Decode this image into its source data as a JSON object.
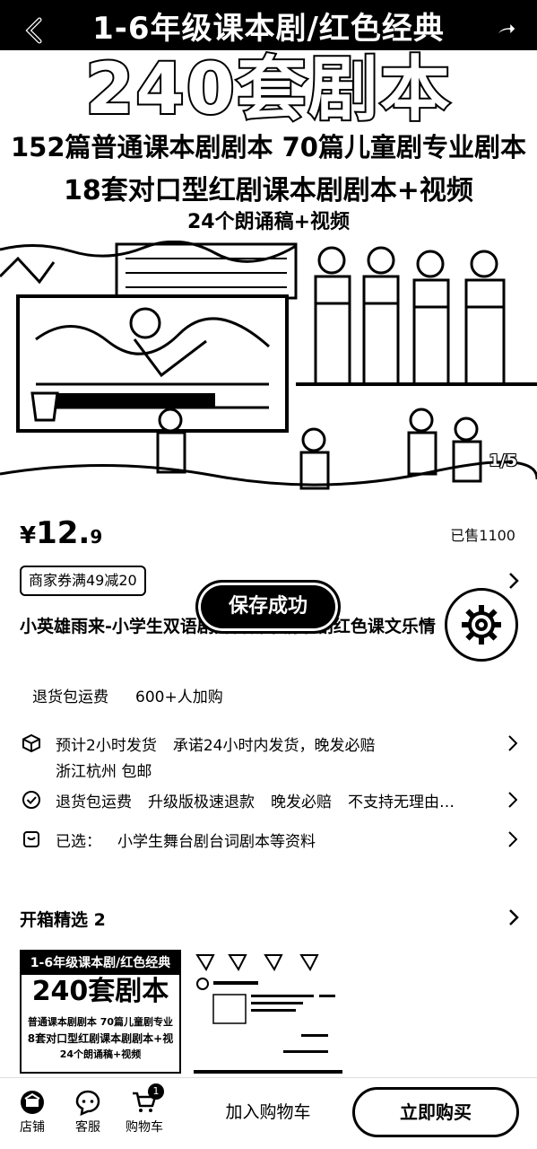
{
  "banner": {
    "header": "1-6年级课本剧/红色经典",
    "big_title": "240套剧本",
    "line1": "152篇普通课本剧剧本 70篇儿童剧专业剧本",
    "line2": "18套对口型红剧课本剧剧本+视频",
    "line3": "24个朗诵稿+视频"
  },
  "image_counter": "1/5",
  "price": {
    "currency": "¥",
    "integer": "12.",
    "decimal": "9"
  },
  "sold": "已售1100",
  "coupon": "商家券满49减20",
  "toast": "保存成功",
  "title": "小英雄雨来-小学生双语剧舞台剧本情景剧红色课文乐情",
  "tags": [
    "退货包运费",
    "600+人加购"
  ],
  "shipping": {
    "eta": "预计2小时发货",
    "promise": "承诺24小时内发货，晚发必赔",
    "origin": "浙江杭州 包邮"
  },
  "service": [
    "退货包运费",
    "升级版极速退款",
    "晚发必赔",
    "不支持无理由…"
  ],
  "selected": {
    "label": "已选：",
    "value": "小学生舞台剧台词剧本等资料"
  },
  "unboxing": {
    "title": "开箱精选 2",
    "thumb1": {
      "header": "1-6年级课本剧/红色经典",
      "big": "240套剧本",
      "l1": "普通课本剧剧本 70篇儿童剧专业",
      "l2": "8套对口型红剧课本剧剧本+视",
      "l3": "24个朗诵稿+视频"
    }
  },
  "bottom_bar": {
    "store": "店铺",
    "service": "客服",
    "cart": "购物车",
    "cart_count": "1",
    "add_to_cart": "加入购物车",
    "buy_now": "立即购买"
  }
}
